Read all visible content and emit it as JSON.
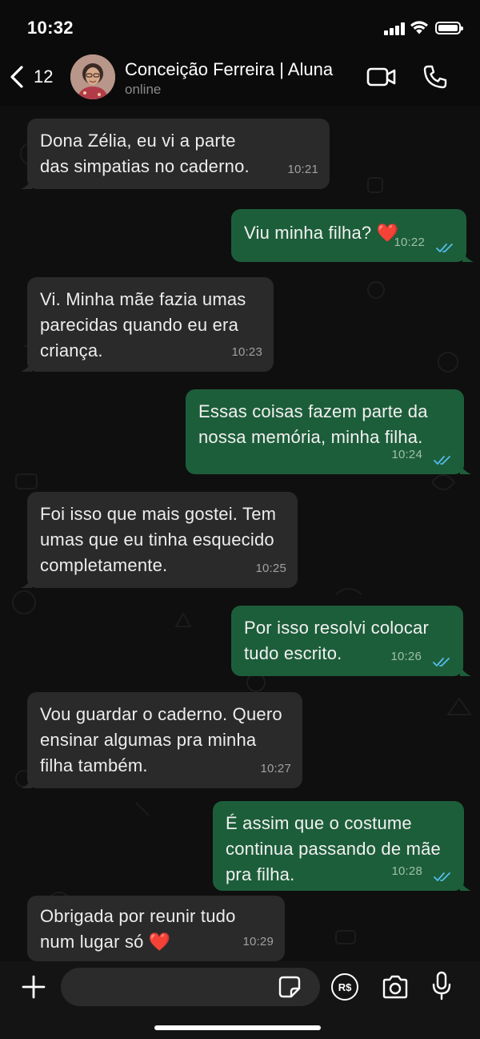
{
  "status_bar": {
    "time": "10:32"
  },
  "header": {
    "back_count": "12",
    "contact_name": "Conceição Ferreira | Aluna",
    "contact_status": "online"
  },
  "messages": [
    {
      "direction": "in",
      "text": "Dona Zélia, eu vi a parte\ndas simpatias no caderno.",
      "time": "10:21"
    },
    {
      "direction": "out",
      "text": "Viu minha filha? ❤️",
      "time": "10:22",
      "read": true
    },
    {
      "direction": "in",
      "text": "Vi. Minha mãe fazia umas\nparecidas quando eu era\ncriança.",
      "time": "10:23"
    },
    {
      "direction": "out",
      "text": "Essas coisas fazem parte da\nnossa memória, minha filha.",
      "time": "10:24",
      "read": true
    },
    {
      "direction": "in",
      "text": "Foi isso que mais gostei. Tem\numas que eu tinha esquecido\ncompletamente.",
      "time": "10:25"
    },
    {
      "direction": "out",
      "text": "Por isso resolvi colocar\ntudo escrito.",
      "time": "10:26",
      "read": true
    },
    {
      "direction": "in",
      "text": "Vou guardar o caderno. Quero\nensinar algumas pra minha\nfilha também.",
      "time": "10:27"
    },
    {
      "direction": "out",
      "text": "É assim que o costume\ncontinua passando de mãe\npra filha.",
      "time": "10:28",
      "read": true
    },
    {
      "direction": "in",
      "text": "Obrigada por reunir tudo\nnum lugar só ❤️",
      "time": "10:29"
    }
  ],
  "composer": {
    "input_value": "",
    "input_placeholder": "",
    "pay_label": "R$"
  },
  "colors": {
    "incoming_bubble": "#2a2a2a",
    "outgoing_bubble": "#1d5e3a",
    "read_ticks": "#53bdeb"
  },
  "icons": {
    "back": "chevron-left-icon",
    "video": "video-camera-icon",
    "call": "phone-icon",
    "plus": "plus-icon",
    "sticker": "sticker-icon",
    "pay": "pay-icon",
    "camera": "camera-icon",
    "mic": "microphone-icon"
  }
}
